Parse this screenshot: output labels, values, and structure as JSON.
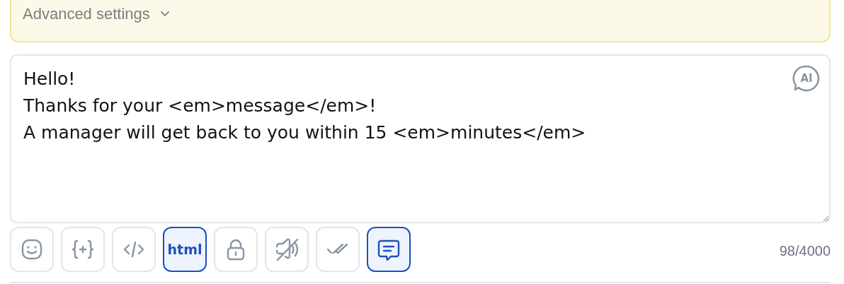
{
  "advanced_settings": {
    "label": "Advanced settings",
    "expanded": false
  },
  "message": {
    "value": "Hello!\nThanks for your <em>message</em>!\nA manager will get back to you within 15 <em>minutes</em>"
  },
  "ai_button": {
    "label": "AI"
  },
  "toolbar": [
    {
      "kind": "emoji",
      "selected": false
    },
    {
      "kind": "variable",
      "selected": false
    },
    {
      "kind": "code",
      "selected": false
    },
    {
      "kind": "text",
      "label": "html",
      "selected": true
    },
    {
      "kind": "lock",
      "selected": false
    },
    {
      "kind": "mute",
      "selected": false
    },
    {
      "kind": "read",
      "selected": false
    },
    {
      "kind": "chat",
      "selected": true
    }
  ],
  "counter": "98/4000"
}
